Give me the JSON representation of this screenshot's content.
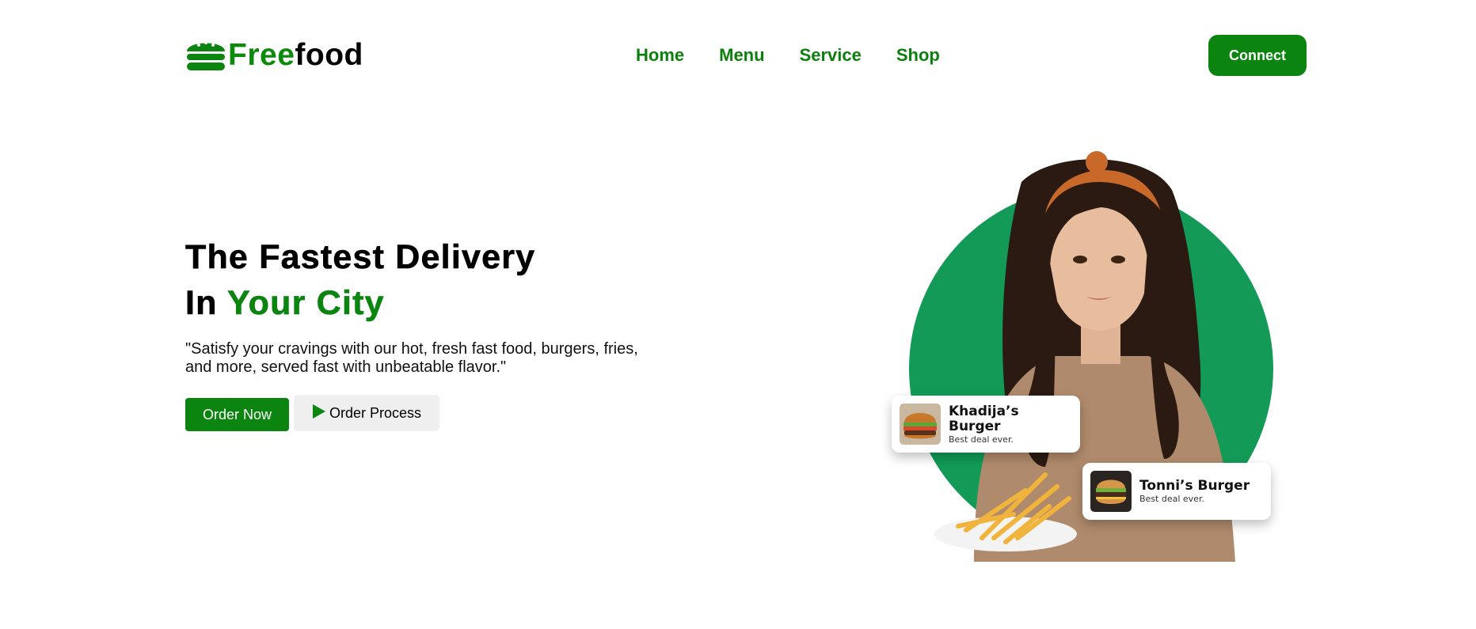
{
  "header": {
    "logo": {
      "part1": "Free",
      "part2": "food",
      "icon": "burger-icon"
    },
    "nav": [
      "Home",
      "Menu",
      "Service",
      "Shop"
    ],
    "connect_label": "Connect"
  },
  "hero": {
    "title_line1": "The Fastest Delivery",
    "title_line2_prefix": "In ",
    "title_line2_highlight": "Your City",
    "description": "\"Satisfy your cravings with our hot, fresh fast food, burgers, fries, and more, served fast with unbeatable flavor.\"",
    "order_now_label": "Order Now",
    "order_process_label": "Order Process"
  },
  "cards": [
    {
      "title": "Khadija’s Burger",
      "subtitle": "Best deal ever."
    },
    {
      "title": "Tonni’s Burger",
      "subtitle": "Best deal ever."
    }
  ],
  "colors": {
    "brand_green": "#0b8410",
    "circle_green": "#129a56"
  }
}
